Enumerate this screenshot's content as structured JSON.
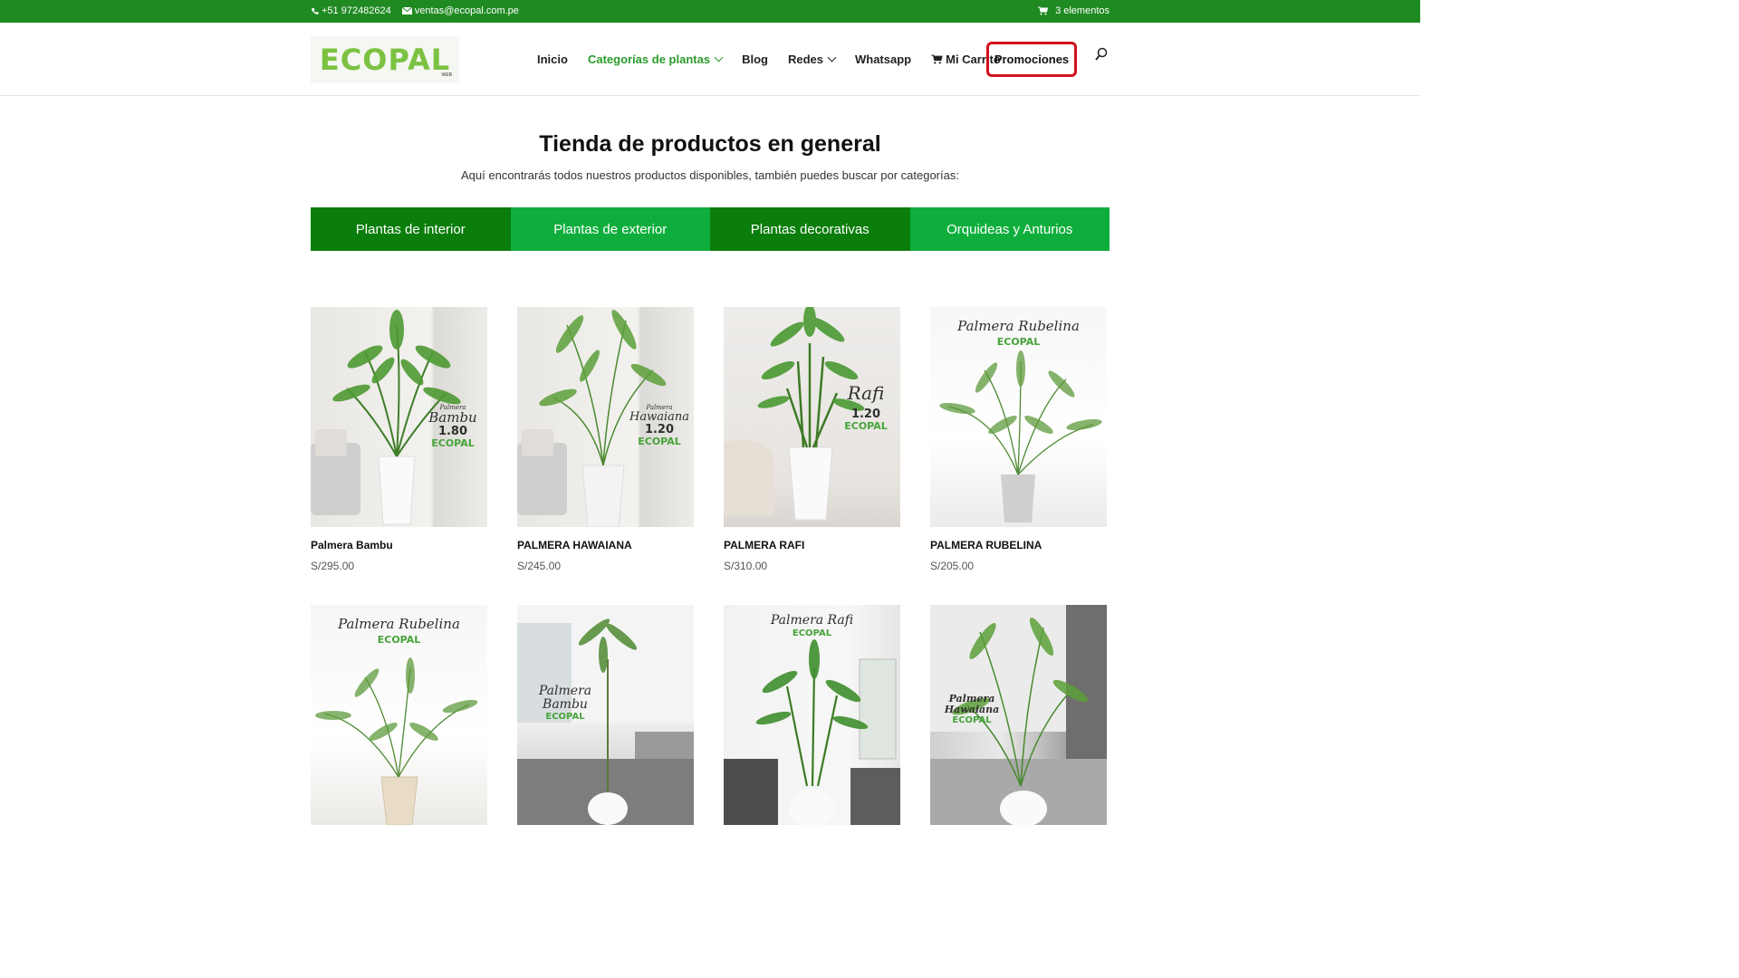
{
  "topbar": {
    "phone": "+51 972482624",
    "email": "ventas@ecopal.com.pe",
    "cart": "3 elementos"
  },
  "logo": {
    "text": "ECOPAL",
    "small": "WEB"
  },
  "nav": {
    "items": [
      {
        "label": "Inicio"
      },
      {
        "label": "Categorías de plantas"
      },
      {
        "label": "Blog"
      },
      {
        "label": "Redes"
      },
      {
        "label": "Whatsapp"
      },
      {
        "label": "Mi Carrito"
      }
    ],
    "promo": "Promociones"
  },
  "page": {
    "title": "Tienda de productos en general",
    "subtitle": "Aquí encontrarás todos nuestros productos disponibles, también puedes buscar por categorías:"
  },
  "categories": [
    {
      "label": "Plantas de interior",
      "color": "#0a7d0a"
    },
    {
      "label": "Plantas de exterior",
      "color": "#0fae3c"
    },
    {
      "label": "Plantas decorativas",
      "color": "#0a7d0a"
    },
    {
      "label": "Orquideas y Anturios",
      "color": "#0fae3c"
    }
  ],
  "products": [
    {
      "name": "Palmera Bambu",
      "price": "S/295.00",
      "img_line1": "Palmera",
      "img_line2": "Bambu",
      "img_line3": "1.80",
      "img_brand": "ECOPAL"
    },
    {
      "name": "PALMERA HAWAIANA",
      "price": "S/245.00",
      "img_line1": "Palmera",
      "img_line2": "Hawaiana",
      "img_line3": "1.20",
      "img_brand": "ECOPAL"
    },
    {
      "name": "PALMERA RAFI",
      "price": "S/310.00",
      "img_line1": "",
      "img_line2": "Rafi",
      "img_line3": "1.20",
      "img_brand": "ECOPAL"
    },
    {
      "name": "PALMERA RUBELINA",
      "price": "S/205.00",
      "img_line1": "",
      "img_line2": "Palmera Rubelina",
      "img_line3": "",
      "img_brand": "ECOPAL"
    }
  ],
  "products_row2": [
    {
      "img_line2": "Palmera Rubelina",
      "img_brand": "ECOPAL"
    },
    {
      "img_line2": "Palmera Bambu",
      "img_brand": "ECOPAL"
    },
    {
      "img_line2": "Palmera Rafi",
      "img_brand": "ECOPAL"
    },
    {
      "img_line2": "Palmera Hawaiana",
      "img_brand": "ECOPAL"
    }
  ]
}
